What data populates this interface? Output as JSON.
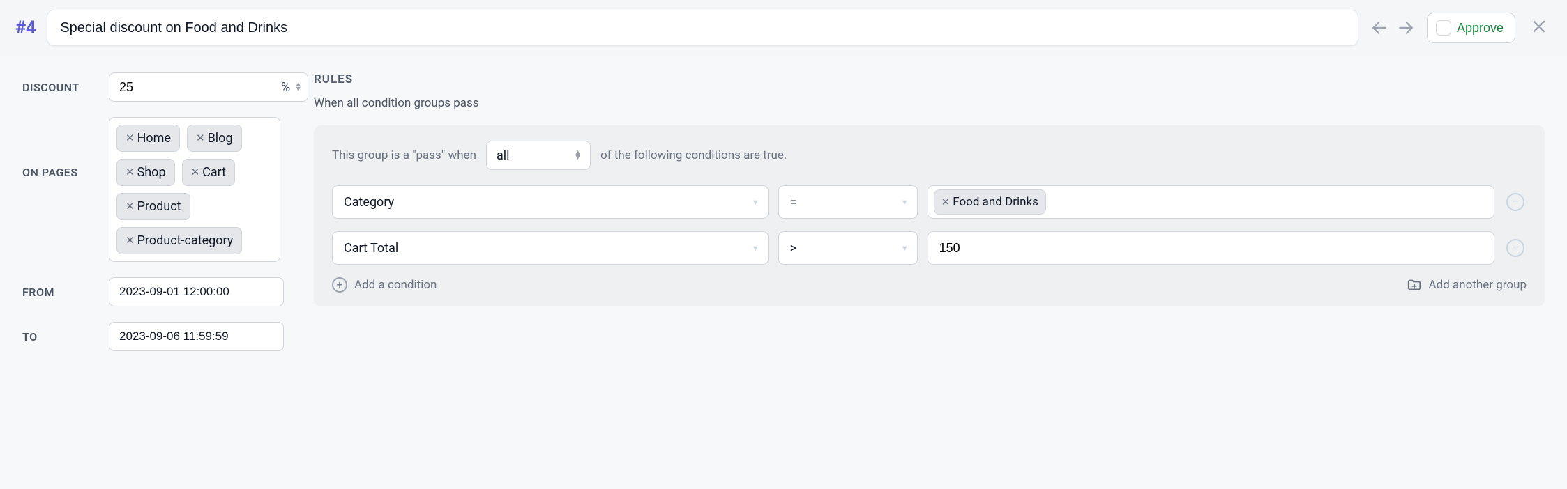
{
  "header": {
    "record_id": "#4",
    "title": "Special discount on Food and Drinks",
    "approve_label": "Approve"
  },
  "discount": {
    "label": "DISCOUNT",
    "value": "25",
    "unit": "%"
  },
  "pages": {
    "label": "ON PAGES",
    "tags": [
      "Home",
      "Blog",
      "Shop",
      "Cart",
      "Product",
      "Product-category"
    ]
  },
  "from": {
    "label": "FROM",
    "value": "2023-09-01 12:00:00"
  },
  "to": {
    "label": "TO",
    "value": "2023-09-06 11:59:59"
  },
  "rules": {
    "label": "RULES",
    "subtitle": "When all condition groups pass",
    "group": {
      "prefix": "This group is a \"pass\" when",
      "mode": "all",
      "suffix": "of the following conditions are true.",
      "conditions": [
        {
          "field": "Category",
          "op": "=",
          "value_tag": "Food and Drinks",
          "value_text": ""
        },
        {
          "field": "Cart Total",
          "op": ">",
          "value_tag": "",
          "value_text": "150"
        }
      ],
      "add_condition": "Add a condition",
      "add_group": "Add another group"
    }
  }
}
